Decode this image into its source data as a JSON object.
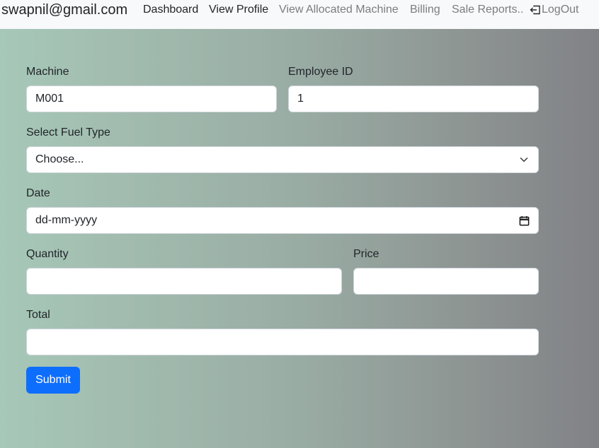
{
  "nav": {
    "brand": "swapnil@gmail.com",
    "links": [
      {
        "label": "Dashboard"
      },
      {
        "label": "View Profile"
      },
      {
        "label": "View Allocated Machine"
      },
      {
        "label": "Billing"
      },
      {
        "label": "Sale Reports.."
      },
      {
        "label": "LogOut"
      }
    ],
    "logout_icon": "box-arrow-left-icon"
  },
  "form": {
    "machine": {
      "label": "Machine",
      "value": "M001"
    },
    "employee_id": {
      "label": "Employee ID",
      "value": "1"
    },
    "fuel_type": {
      "label": "Select Fuel Type",
      "selected": "Choose...",
      "icon": "chevron-down-icon"
    },
    "date": {
      "label": "Date",
      "placeholder": "dd-mm-yyyy",
      "icon": "calendar-icon"
    },
    "quantity": {
      "label": "Quantity",
      "value": ""
    },
    "price": {
      "label": "Price",
      "value": ""
    },
    "total": {
      "label": "Total",
      "value": ""
    },
    "submit_label": "Submit"
  },
  "colors": {
    "navbar_bg": "#f8f9fa",
    "primary": "#0d6efd",
    "gradient_start": "#a6c8b8",
    "gradient_end": "#818286"
  }
}
